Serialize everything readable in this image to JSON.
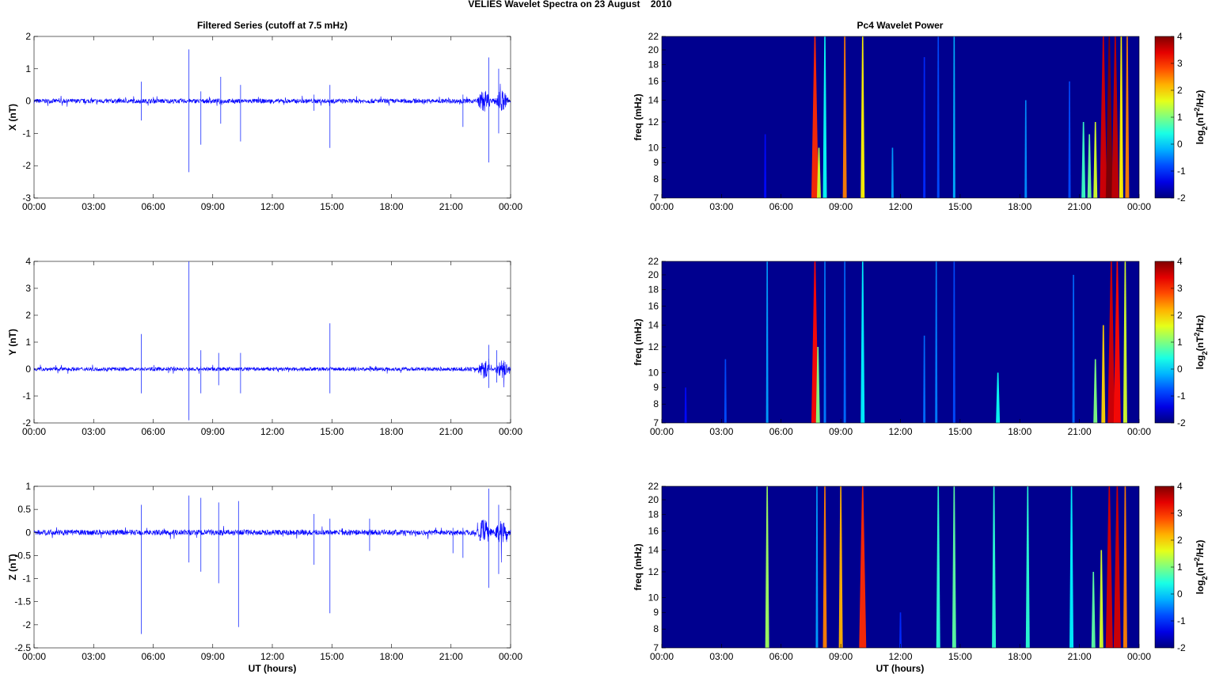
{
  "chart_data": {
    "title": "VELIES Wavelet Spectra on 23 August    2010",
    "left_title": "Filtered Series (cutoff at 7.5 mHz)",
    "right_title": "Pc4 Wavelet Power",
    "xlabel": "UT (hours)",
    "xticks": [
      "00:00",
      "03:00",
      "06:00",
      "09:00",
      "12:00",
      "15:00",
      "18:00",
      "21:00",
      "00:00"
    ],
    "xlim": [
      0,
      24
    ],
    "freq_label": "freq (mHz)",
    "freq_ticks": [
      7,
      8,
      9,
      10,
      12,
      14,
      16,
      18,
      20,
      22
    ],
    "freq_lim": [
      7,
      22
    ],
    "colorbar": {
      "label": "log2(nT^2/Hz)",
      "label_main": "log",
      "label_sub": "2",
      "label_rest": "(nT",
      "label_sup": "2",
      "label_end": "/Hz)",
      "ticks": [
        -2,
        -1,
        0,
        1,
        2,
        3,
        4
      ],
      "clim": [
        -2,
        4
      ]
    },
    "series": [
      {
        "name": "X (nT)",
        "ylim": [
          -3,
          2
        ],
        "yticks": [
          "-3",
          "-2",
          "-1",
          "0",
          "1",
          "2"
        ],
        "noise": 0.07,
        "spikes": [
          [
            5.4,
            0.6,
            -0.6
          ],
          [
            7.8,
            1.6,
            -2.2
          ],
          [
            8.4,
            0.3,
            -1.35
          ],
          [
            9.4,
            0.75,
            -0.7
          ],
          [
            10.4,
            0.5,
            -1.25
          ],
          [
            14.1,
            0.2,
            -0.3
          ],
          [
            14.9,
            0.5,
            -1.45
          ],
          [
            21.6,
            0.2,
            -0.8
          ],
          [
            22.9,
            1.35,
            -1.9
          ],
          [
            23.4,
            1.0,
            -1.0
          ]
        ],
        "bursts": [
          [
            5.2,
            -1.2,
            11
          ],
          [
            7.7,
            3,
            22
          ],
          [
            7.9,
            1.5,
            10
          ],
          [
            8.2,
            0.3,
            22
          ],
          [
            9.2,
            2.5,
            22
          ],
          [
            10.1,
            1.8,
            22
          ],
          [
            11.6,
            -0.3,
            10
          ],
          [
            13.2,
            -1,
            19
          ],
          [
            13.9,
            -0.8,
            22
          ],
          [
            14.7,
            -0.2,
            22
          ],
          [
            18.3,
            -0.4,
            14
          ],
          [
            20.5,
            -0.8,
            16
          ],
          [
            21.2,
            0.6,
            12
          ],
          [
            21.5,
            0.9,
            11
          ],
          [
            21.8,
            1.5,
            12
          ],
          [
            22.2,
            3.5,
            22
          ],
          [
            22.5,
            4,
            22
          ],
          [
            22.8,
            3.6,
            22
          ],
          [
            23.1,
            1.8,
            22
          ],
          [
            23.4,
            2.5,
            22
          ]
        ]
      },
      {
        "name": "Y (nT)",
        "ylim": [
          -2,
          4
        ],
        "yticks": [
          "-2",
          "-1",
          "0",
          "1",
          "2",
          "3",
          "4"
        ],
        "noise": 0.07,
        "spikes": [
          [
            5.4,
            1.3,
            -0.9
          ],
          [
            7.8,
            4,
            -1.9
          ],
          [
            8.4,
            0.7,
            -0.9
          ],
          [
            9.3,
            0.6,
            -0.6
          ],
          [
            10.4,
            0.6,
            -0.9
          ],
          [
            14.9,
            1.7,
            -0.9
          ],
          [
            22.9,
            0.9,
            -0.7
          ],
          [
            23.3,
            0.7,
            -0.5
          ]
        ],
        "bursts": [
          [
            1.2,
            -1.2,
            9
          ],
          [
            3.2,
            -0.8,
            11
          ],
          [
            5.3,
            -0.3,
            22
          ],
          [
            7.7,
            3.2,
            22
          ],
          [
            7.85,
            1,
            12
          ],
          [
            8.2,
            -0.5,
            22
          ],
          [
            9.2,
            -0.6,
            22
          ],
          [
            10.1,
            0.2,
            22
          ],
          [
            13.2,
            -0.6,
            13
          ],
          [
            13.8,
            -0.5,
            22
          ],
          [
            14.7,
            -0.8,
            22
          ],
          [
            16.9,
            0.3,
            10
          ],
          [
            20.7,
            -0.6,
            20
          ],
          [
            21.8,
            1,
            11
          ],
          [
            22.2,
            2,
            14
          ],
          [
            22.6,
            3.5,
            22
          ],
          [
            22.9,
            3.2,
            22
          ],
          [
            23.3,
            1.5,
            22
          ]
        ]
      },
      {
        "name": "Z (nT)",
        "ylim": [
          -2.5,
          1
        ],
        "yticks": [
          "-2.5",
          "-2",
          "-1.5",
          "-1",
          "-0.5",
          "0",
          "0.5",
          "1"
        ],
        "noise": 0.06,
        "spikes": [
          [
            5.4,
            0.6,
            -2.2
          ],
          [
            7.8,
            0.8,
            -0.65
          ],
          [
            8.4,
            0.75,
            -0.85
          ],
          [
            9.3,
            0.65,
            -1.1
          ],
          [
            10.3,
            0.68,
            -2.05
          ],
          [
            14.1,
            0.4,
            -0.7
          ],
          [
            14.9,
            0.3,
            -1.75
          ],
          [
            16.9,
            0.3,
            -0.4
          ],
          [
            21.1,
            0.1,
            -0.45
          ],
          [
            21.6,
            0.1,
            -0.55
          ],
          [
            22.9,
            0.95,
            -1.2
          ],
          [
            23.4,
            0.6,
            -0.9
          ]
        ],
        "bursts": [
          [
            5.3,
            1.2,
            22
          ],
          [
            7.8,
            -0.3,
            22
          ],
          [
            8.2,
            2.5,
            22
          ],
          [
            9.0,
            2.2,
            22
          ],
          [
            10.1,
            3,
            22
          ],
          [
            12.0,
            -1,
            9
          ],
          [
            13.9,
            0.5,
            22
          ],
          [
            14.7,
            0.8,
            22
          ],
          [
            16.7,
            0.5,
            22
          ],
          [
            18.4,
            0.5,
            22
          ],
          [
            20.6,
            0.2,
            22
          ],
          [
            21.7,
            0.8,
            12
          ],
          [
            22.1,
            1.5,
            14
          ],
          [
            22.5,
            3.5,
            22
          ],
          [
            22.9,
            3.5,
            22
          ],
          [
            23.3,
            2.5,
            22
          ]
        ]
      }
    ]
  }
}
